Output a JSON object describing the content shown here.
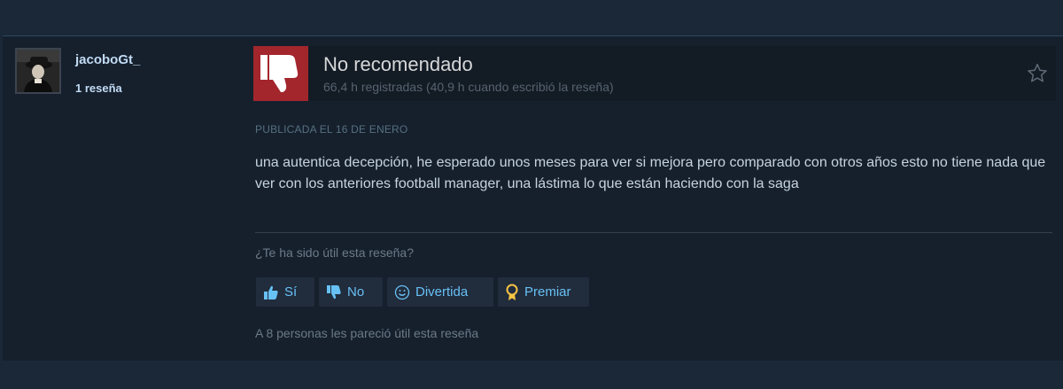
{
  "author": {
    "name": "jacoboGt_",
    "review_count": "1 reseña"
  },
  "review": {
    "verdict": "No recomendado",
    "hours": "66,4 h registradas (40,9 h cuando escribió la reseña)",
    "posted": "PUBLICADA EL 16 DE ENERO",
    "text": "una autentica decepción, he esperado unos meses para ver si mejora pero comparado con otros años esto no tiene nada que ver con los anteriores football manager, una lástima lo que están haciendo con la saga",
    "thumb_icon": "thumbs-down-icon",
    "thumb_color": "#a3262c"
  },
  "helpful": {
    "question": "¿Te ha sido útil esta reseña?",
    "yes_label": "Sí",
    "no_label": "No",
    "funny_label": "Divertida",
    "award_label": "Premiar",
    "count_text": "A 8 personas les pareció útil esta reseña"
  },
  "colors": {
    "background": "#1b2838",
    "panel": "#16202d",
    "link": "#67c1f5",
    "award": "#f6c344"
  }
}
